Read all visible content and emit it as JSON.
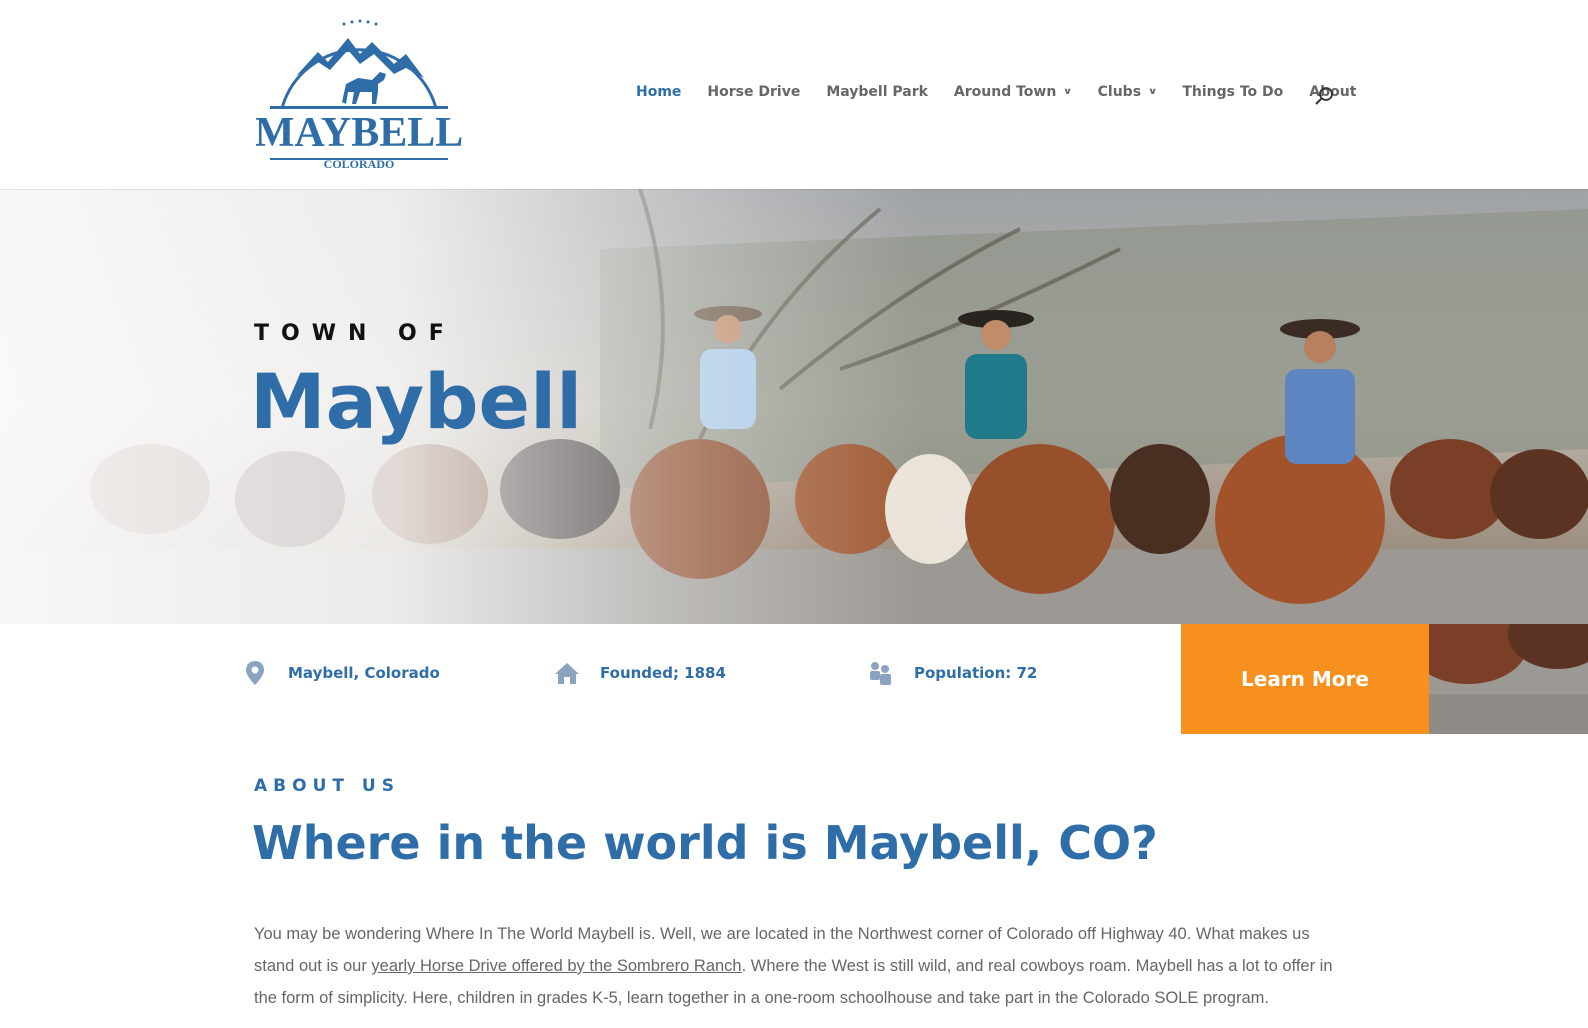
{
  "logo": {
    "main_text": "MAYBELL",
    "sub_text": "COLORADO"
  },
  "nav": {
    "items": [
      {
        "label": "Home",
        "active": true,
        "dropdown": false
      },
      {
        "label": "Horse Drive",
        "active": false,
        "dropdown": false
      },
      {
        "label": "Maybell Park",
        "active": false,
        "dropdown": false
      },
      {
        "label": "Around Town",
        "active": false,
        "dropdown": true
      },
      {
        "label": "Clubs",
        "active": false,
        "dropdown": true
      },
      {
        "label": "Things To Do",
        "active": false,
        "dropdown": false
      },
      {
        "label": "About",
        "active": false,
        "dropdown": false
      }
    ],
    "search_icon": "search-icon"
  },
  "hero": {
    "kicker": "TOWN OF",
    "title": "Maybell"
  },
  "info": {
    "location": {
      "icon": "map-pin-icon",
      "text": "Maybell, Colorado"
    },
    "founded": {
      "icon": "house-icon",
      "text": "Founded; 1884"
    },
    "population": {
      "icon": "people-icon",
      "text": "Population: 72"
    },
    "cta_label": "Learn More"
  },
  "about": {
    "kicker": "ABOUT US",
    "title": "Where in the world is Maybell, CO?",
    "body_before": "You may be wondering Where In The World Maybell is. Well, we are located in the Northwest corner of Colorado off Highway 40. What makes us stand out is our ",
    "body_link": "yearly Horse Drive offered by the Sombrero Ranch",
    "body_after": ". Where the West is still wild, and real cowboys roam. Maybell has a lot to offer in the form of simplicity. Here, children in grades K-5, learn together in a one-room schoolhouse and take part in the Colorado SOLE program."
  },
  "colors": {
    "brand_blue": "#2f6da8",
    "accent_orange": "#f7901e",
    "text_gray": "#666666"
  }
}
